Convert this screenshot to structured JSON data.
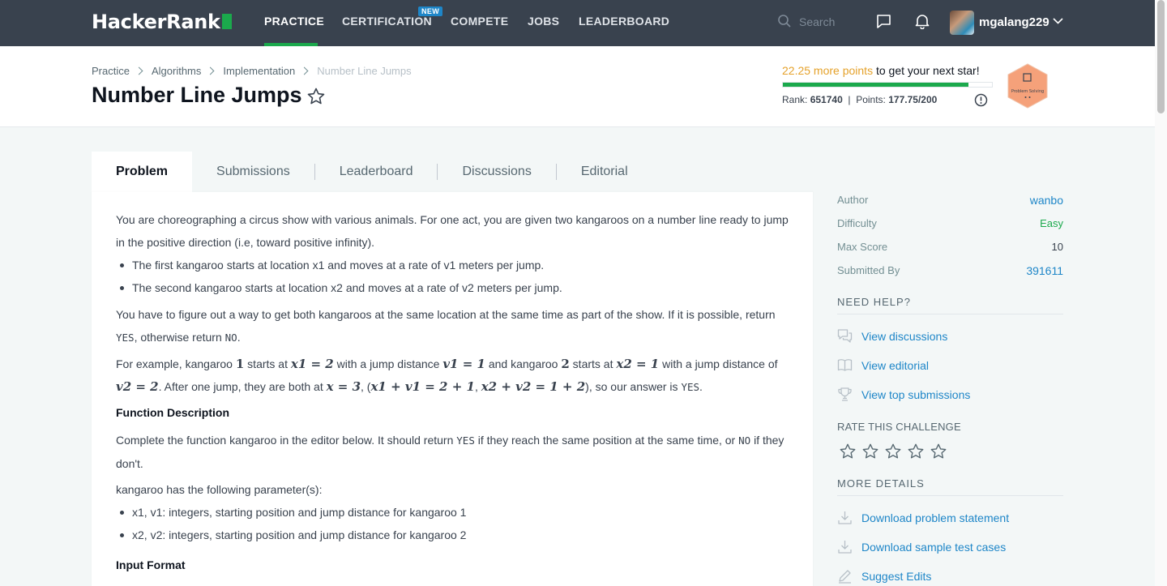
{
  "nav": {
    "logo": "HackerRank",
    "items": [
      "PRACTICE",
      "CERTIFICATION",
      "COMPETE",
      "JOBS",
      "LEADERBOARD"
    ],
    "new_badge": "NEW",
    "search_placeholder": "Search",
    "username": "mgalang229"
  },
  "breadcrumb": [
    "Practice",
    "Algorithms",
    "Implementation",
    "Number Line Jumps"
  ],
  "title": "Number Line Jumps",
  "progress": {
    "points_needed": "22.25 more points",
    "suffix": " to get your next star!",
    "fraction": 0.8888,
    "rank_label": "Rank:",
    "rank": "651740",
    "points_label": "Points:",
    "points": "177.75/200",
    "badge_label": "Problem Solving"
  },
  "tabs": [
    "Problem",
    "Submissions",
    "Leaderboard",
    "Discussions",
    "Editorial"
  ],
  "problem": {
    "intro": "You are choreographing a circus show with various animals. For one act, you are given two kangaroos on a number line ready to jump in the positive direction (i.e, toward positive infinity).",
    "bullet1_a": "The first kangaroo starts at location ",
    "bullet1_b": " and moves at a rate of ",
    "bullet1_c": " meters per jump.",
    "bullet2_a": "The second kangaroo starts at location ",
    "bullet2_b": " and moves at a rate of ",
    "bullet2_c": " meters per jump.",
    "para2_a": "You have to figure out a way to get both kangaroos at the same location at the same time as part of the show. If it is possible, return ",
    "yes": "YES",
    "para2_b": ", otherwise return ",
    "no": "NO",
    "example_a": "For example, kangaroo ",
    "example_b": " starts at ",
    "example_c": " with a jump distance ",
    "example_d": " and kangaroo ",
    "example_e": " starts at ",
    "example_f": " with a jump distance of ",
    "example_g": ". After one jump, they are both at ",
    "example_h": ", (",
    "example_i": ", ",
    "example_j": "), so our answer is ",
    "example_k": ".",
    "func_heading": "Function Description",
    "func_a": "Complete the function kangaroo in the editor below. It should return ",
    "func_b": " if they reach the same position at the same time, or ",
    "func_c": " if they don't.",
    "params_intro": "kangaroo has the following parameter(s):",
    "param1": "x1, v1: integers, starting position and jump distance for kangaroo 1",
    "param2": "x2, v2: integers, starting position and jump distance for kangaroo 2",
    "input_heading": "Input Format",
    "math": {
      "x1": "x1",
      "v1": "v1",
      "x2": "x2",
      "v2": "v2",
      "k1": "1",
      "k2": "2",
      "x1eq": "x1 = 2",
      "v1eq": "v1 = 1",
      "x2eq": "x2 = 1",
      "v2eq": "v2 = 2",
      "xeq": "x = 3",
      "s1": "x1 + v1 = 2 + 1",
      "s2": "x2 + v2 = 1 + 2"
    }
  },
  "sidebar": {
    "author_label": "Author",
    "author": "wanbo",
    "difficulty_label": "Difficulty",
    "difficulty": "Easy",
    "max_score_label": "Max Score",
    "max_score": "10",
    "submitted_label": "Submitted By",
    "submitted": "391611",
    "need_help": "NEED HELP?",
    "help_links": [
      "View discussions",
      "View editorial",
      "View top submissions"
    ],
    "rate": "RATE THIS CHALLENGE",
    "rating": 0,
    "more_details": "MORE DETAILS",
    "detail_links": [
      "Download problem statement",
      "Download sample test cases",
      "Suggest Edits"
    ]
  },
  "colors": {
    "nav_bg": "#39424e",
    "accent_green": "#1ba94c",
    "link_blue": "#1e86c8",
    "points_orange": "#e5a22b",
    "badge_orange": "#f5a17a"
  }
}
